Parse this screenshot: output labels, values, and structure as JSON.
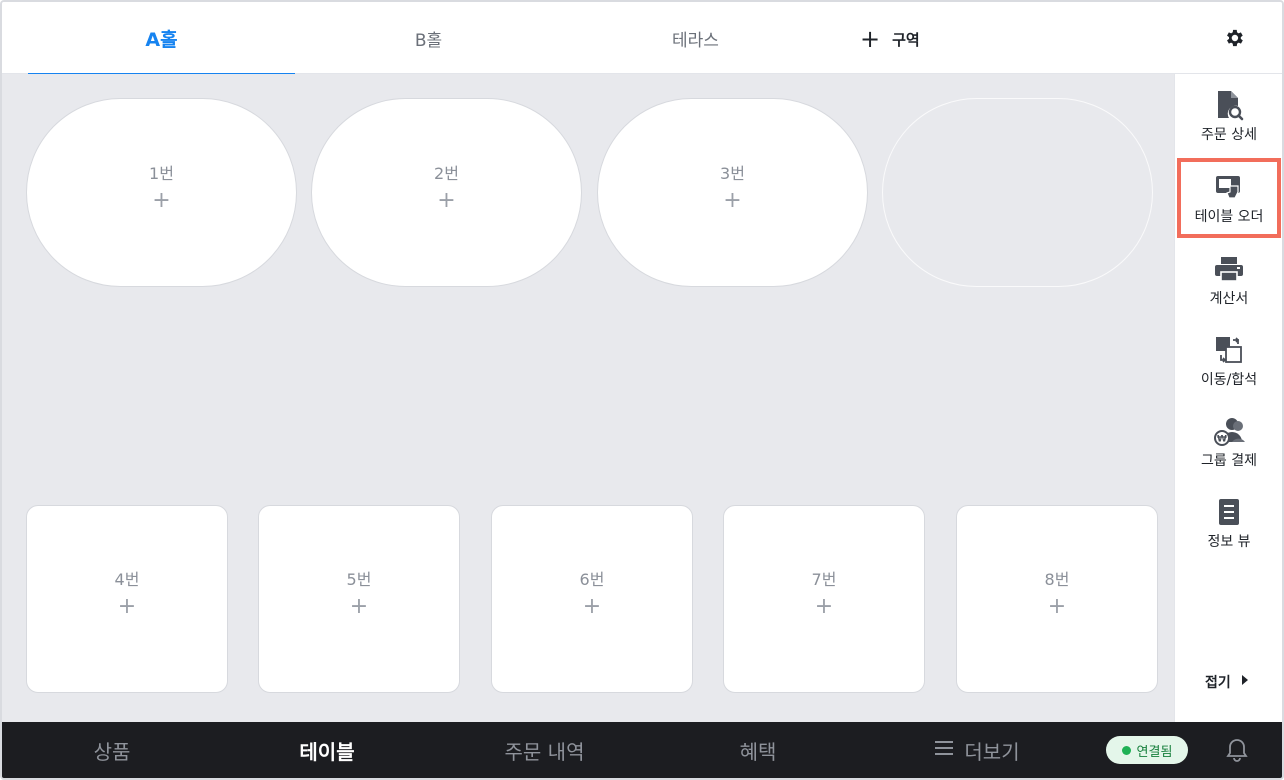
{
  "tabs": [
    {
      "label": "A홀",
      "active": true
    },
    {
      "label": "B홀",
      "active": false
    },
    {
      "label": "테라스",
      "active": false
    }
  ],
  "add_zone": {
    "icon": "plus-icon",
    "label": "구역"
  },
  "settings": {
    "icon": "gear-icon"
  },
  "oval_tables": [
    {
      "name": "1번",
      "plus": "+"
    },
    {
      "name": "2번",
      "plus": "+"
    },
    {
      "name": "3번",
      "plus": "+"
    }
  ],
  "rect_tables": [
    {
      "name": "4번",
      "plus": "+"
    },
    {
      "name": "5번",
      "plus": "+"
    },
    {
      "name": "6번",
      "plus": "+"
    },
    {
      "name": "7번",
      "plus": "+"
    },
    {
      "name": "8번",
      "plus": "+"
    }
  ],
  "sidebar": {
    "items": [
      {
        "label": "주문 상세",
        "icon": "document-search-icon"
      },
      {
        "label": "테이블 오더",
        "icon": "tablet-order-icon",
        "highlighted": true
      },
      {
        "label": "계산서",
        "icon": "printer-icon"
      },
      {
        "label": "이동/합석",
        "icon": "move-merge-icon"
      },
      {
        "label": "그룹 결제",
        "icon": "group-payment-icon"
      },
      {
        "label": "정보 뷰",
        "icon": "info-list-icon"
      }
    ],
    "fold_label": "접기",
    "fold_icon": "caret-right-icon"
  },
  "bottom_nav": {
    "items": [
      {
        "label": "상품",
        "active": false
      },
      {
        "label": "테이블",
        "active": true
      },
      {
        "label": "주문 내역",
        "active": false
      },
      {
        "label": "혜택",
        "active": false
      },
      {
        "label": "더보기",
        "active": false,
        "icon": "menu-icon"
      }
    ],
    "status": {
      "label": "연결됨",
      "color": "#1fb155"
    },
    "bell_icon": "bell-icon"
  },
  "colors": {
    "accent": "#1683f0",
    "highlight_border": "#f26d5b",
    "floor_bg": "#e8e9ed",
    "bottom_bg": "#1c1d21"
  }
}
